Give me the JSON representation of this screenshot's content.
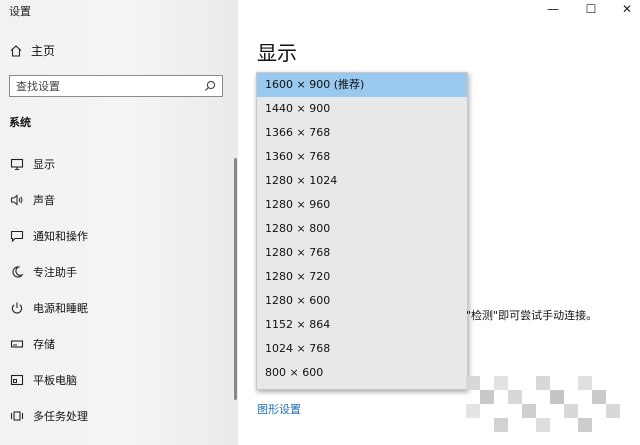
{
  "app_title": "设置",
  "window_controls": {
    "minimize": "—",
    "maximize": "☐",
    "close": "✕"
  },
  "sidebar": {
    "home_label": "主页",
    "search_placeholder": "查找设置",
    "section_title": "系统",
    "items": [
      {
        "label": "显示",
        "icon": "monitor-icon",
        "active": true
      },
      {
        "label": "声音",
        "icon": "speaker-icon"
      },
      {
        "label": "通知和操作",
        "icon": "message-icon"
      },
      {
        "label": "专注助手",
        "icon": "moon-icon"
      },
      {
        "label": "电源和睡眠",
        "icon": "power-icon"
      },
      {
        "label": "存储",
        "icon": "storage-icon"
      },
      {
        "label": "平板电脑",
        "icon": "tablet-icon"
      },
      {
        "label": "多任务处理",
        "icon": "multitask-icon"
      }
    ]
  },
  "main": {
    "title": "显示",
    "resolution_options": [
      "1600 × 900 (推荐)",
      "1440 × 900",
      "1366 × 768",
      "1360 × 768",
      "1280 × 1024",
      "1280 × 960",
      "1280 × 800",
      "1280 × 768",
      "1280 × 720",
      "1280 × 600",
      "1152 × 864",
      "1024 × 768",
      "800 × 600"
    ],
    "selected_index": 0,
    "hint_text": "\"检测\"即可尝试手动连接。",
    "graphics_link": "图形设置"
  },
  "colors": {
    "selection": "#99c9ef",
    "link": "#1f6fb5"
  }
}
